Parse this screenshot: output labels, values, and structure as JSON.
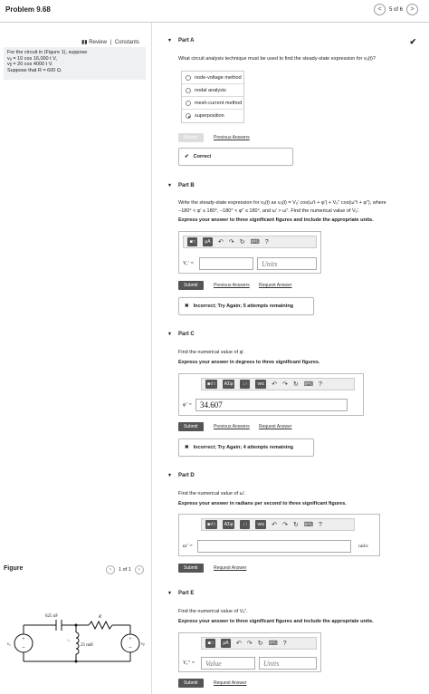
{
  "header": {
    "title": "Problem 9.68",
    "pager": "5 of 6",
    "prev": "<",
    "next": ">"
  },
  "left": {
    "review": "Review",
    "sep": "|",
    "constants": "Constants",
    "problem_line1": "For the circuit in (Figure 1), suppose",
    "problem_line2": "vₐ = 10 cos 16,000 t V,",
    "problem_line3": "vᵦ = 20 cos 4000 t V.",
    "problem_line4": "Suppose that R = 600 Ω.",
    "figure_label": "Figure",
    "figure_pager": "1 of 1",
    "circuit": {
      "cap": "625 nF",
      "ind": "25 mH",
      "res": "R",
      "va": "vₐ",
      "vb": "vᵦ",
      "vo": "vₒ"
    }
  },
  "partA": {
    "title": "Part A",
    "question": "What circuit analysis technique must be used to find the steady-state expression for vₒ(t)?",
    "options": [
      "node-voltage method",
      "nodal analysis",
      "mesh-current method",
      "superposition"
    ],
    "selected": 3,
    "submit": "Submit",
    "prev_answers": "Previous Answers",
    "feedback": "Correct",
    "check": "✔"
  },
  "partB": {
    "title": "Part B",
    "question1": "Write the steady-state expression for vₒ(t) as vₒ(t) = Vₒ′ cos(ω′t + φ′) + Vₒ″ cos(ω″t + φ″), where",
    "question2": "−180° < φ′ ≤ 180°, −180° < φ″ ≤ 180°, and ω′ > ω″. Find the numerical value of Vₒ′.",
    "instruction": "Express your answer to three significant figures and include the appropriate units.",
    "var": "Vₒ′ =",
    "value_placeholder": "",
    "units_placeholder": "Units",
    "submit": "Submit",
    "prev_answers": "Previous Answers",
    "request": "Request Answer",
    "feedback": "Incorrect; Try Again; 5 attempts remaining"
  },
  "partC": {
    "title": "Part C",
    "question": "Find the numerical value of φ′.",
    "instruction": "Express your answer in degrees to three significant figures.",
    "var": "φ′ =",
    "value": "34.607",
    "submit": "Submit",
    "prev_answers": "Previous Answers",
    "request": "Request Answer",
    "feedback": "Incorrect; Try Again; 4 attempts remaining"
  },
  "partD": {
    "title": "Part D",
    "question": "Find the numerical value of ω′.",
    "instruction": "Express your answer in radians per second to three significant figures.",
    "var": "ω′ =",
    "unit": "rad/s",
    "submit": "Submit",
    "request": "Request Answer"
  },
  "partE": {
    "title": "Part E",
    "question": "Find the numerical value of Vₒ″.",
    "instruction": "Express your answer to three significant figures and include the appropriate units.",
    "var": "Vₒ″ =",
    "value_placeholder": "Value",
    "units_placeholder": "Units",
    "submit": "Submit",
    "request": "Request Answer"
  },
  "toolbar": {
    "templates": "■□",
    "mu": "μA",
    "sqrt": "■√□",
    "greek": "AΣφ",
    "arrows": "↓↑",
    "vec": "vec",
    "undo": "↶",
    "redo": "↷",
    "reset": "↻",
    "keyboard": "⌨",
    "help": "?"
  }
}
